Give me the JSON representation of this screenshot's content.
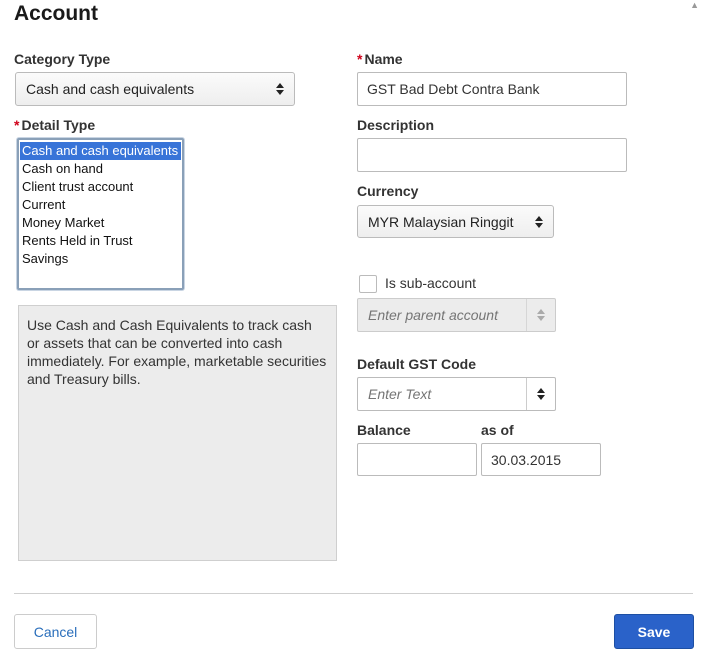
{
  "dialog": {
    "title": "Account"
  },
  "category_type": {
    "label": "Category Type",
    "value": "Cash and cash equivalents"
  },
  "detail_type": {
    "required_mark": "*",
    "label": "Detail Type",
    "items": [
      {
        "label": "Cash and cash equivalents",
        "selected": true
      },
      {
        "label": "Cash on hand",
        "selected": false
      },
      {
        "label": "Client trust account",
        "selected": false
      },
      {
        "label": "Current",
        "selected": false
      },
      {
        "label": "Money Market",
        "selected": false
      },
      {
        "label": "Rents Held in Trust",
        "selected": false
      },
      {
        "label": "Savings",
        "selected": false
      }
    ],
    "description": "Use Cash and Cash Equivalents to track cash or assets that can be converted into cash immediately. For example, marketable securities and Treasury bills."
  },
  "name": {
    "required_mark": "*",
    "label": "Name",
    "value": "GST Bad Debt Contra Bank"
  },
  "description_field": {
    "label": "Description",
    "value": ""
  },
  "currency": {
    "label": "Currency",
    "value": "MYR Malaysian Ringgit"
  },
  "sub_account": {
    "label": "Is sub-account",
    "checked": false,
    "parent_placeholder": "Enter parent account"
  },
  "gst_code": {
    "label": "Default GST Code",
    "placeholder": "Enter Text"
  },
  "balance": {
    "label": "Balance",
    "value": ""
  },
  "as_of": {
    "label": "as of",
    "value": "30.03.2015"
  },
  "footer": {
    "cancel_label": "Cancel",
    "save_label": "Save"
  },
  "colors": {
    "selection": "#3874d8",
    "required": "#d0021b",
    "primary_button": "#2a62c9",
    "link": "#2a6ebb"
  }
}
